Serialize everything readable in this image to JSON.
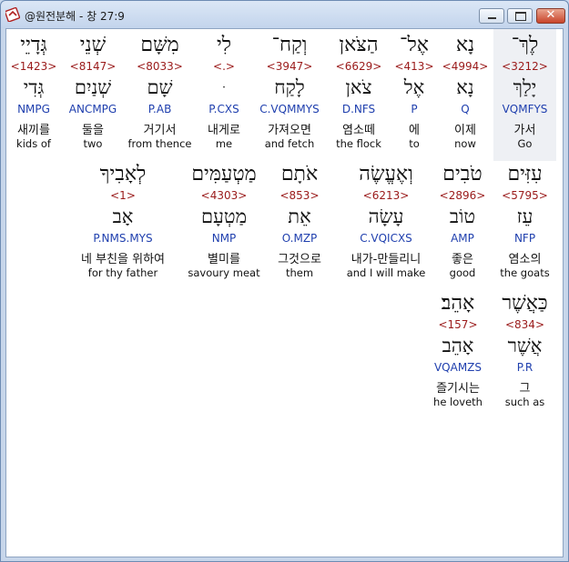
{
  "window": {
    "title": "@원전분해 - 창 27:9",
    "close_glyph": "✕"
  },
  "rows": [
    {
      "words": [
        {
          "heb": "לֶךְ־",
          "strong": "<3212>",
          "lemma": "יָלַךְ",
          "morph": "VQMFYS",
          "korean": "가서",
          "english": "Go",
          "selected": true
        },
        {
          "heb": "נָא",
          "strong": "<4994>",
          "lemma": "נָא",
          "morph": "Q",
          "korean": "이제",
          "english": "now"
        },
        {
          "heb": "אֶל־",
          "strong": "<413>",
          "lemma": "אֶל",
          "morph": "P",
          "korean": "에",
          "english": "to"
        },
        {
          "heb": "הַצֹּאן",
          "strong": "<6629>",
          "lemma": "צֹאן",
          "morph": "D.NFS",
          "korean": "염소떼",
          "english": "the flock"
        },
        {
          "heb": "וְקַח־",
          "strong": "<3947>",
          "lemma": "לָקַח",
          "morph": "C.VQMMYS",
          "korean": "가져오면",
          "english": "and fetch"
        },
        {
          "heb": "לִי",
          "strong": "<.>",
          "lemma": "ּ",
          "morph": "P.CXS",
          "korean": "내게로",
          "english": "me"
        },
        {
          "heb": "מִשָּׁם",
          "strong": "<8033>",
          "lemma": "שָׁם",
          "morph": "P.AB",
          "korean": "거기서",
          "english": "from thence"
        },
        {
          "heb": "שְׁנֵי",
          "strong": "<8147>",
          "lemma": "שְׁנַיִם",
          "morph": "ANCMPG",
          "korean": "둘을",
          "english": "two"
        },
        {
          "heb": "גְּדָיֵי",
          "strong": "<1423>",
          "lemma": "גְּדִי",
          "morph": "NMPG",
          "korean": "새끼를",
          "english": "kids of"
        }
      ]
    },
    {
      "words": [
        {
          "heb": "עִזִּים",
          "strong": "<5795>",
          "lemma": "עֵז",
          "morph": "NFP",
          "korean": "염소의",
          "english": "the goats"
        },
        {
          "heb": "טֹבִים",
          "strong": "<2896>",
          "lemma": "טוֹב",
          "morph": "AMP",
          "korean": "좋은",
          "english": "good"
        },
        {
          "heb": "וְאֶעֱשֶׂה",
          "strong": "<6213>",
          "lemma": "עָשָׂה",
          "morph": "C.VQICXS",
          "korean": "내가-만들리니",
          "english": "and I will make"
        },
        {
          "heb": "אֹתָם",
          "strong": "<853>",
          "lemma": "אֵת",
          "morph": "O.MZP",
          "korean": "그것으로",
          "english": "them"
        },
        {
          "heb": "מַטְעַמִּים",
          "strong": "<4303>",
          "lemma": "מַטְעָם",
          "morph": "NMP",
          "korean": "별미를",
          "english": "savoury meat"
        },
        {
          "heb": "לְאָבִיךָ",
          "strong": "<1>",
          "lemma": "אָב",
          "morph": "P.NMS.MYS",
          "korean": "네 부친을 위하여",
          "english": "for thy father"
        }
      ]
    },
    {
      "words": [
        {
          "heb": "כַּאֲשֶׁר",
          "strong": "<834>",
          "lemma": "אֲשֶׁר",
          "morph": "P.R",
          "korean": "그",
          "english": "such as"
        },
        {
          "heb": "אָהֵב׃",
          "strong": "<157>",
          "lemma": "אָהֵב",
          "morph": "VQAMZS",
          "korean": "즐기시는",
          "english": "he loveth"
        }
      ]
    }
  ]
}
